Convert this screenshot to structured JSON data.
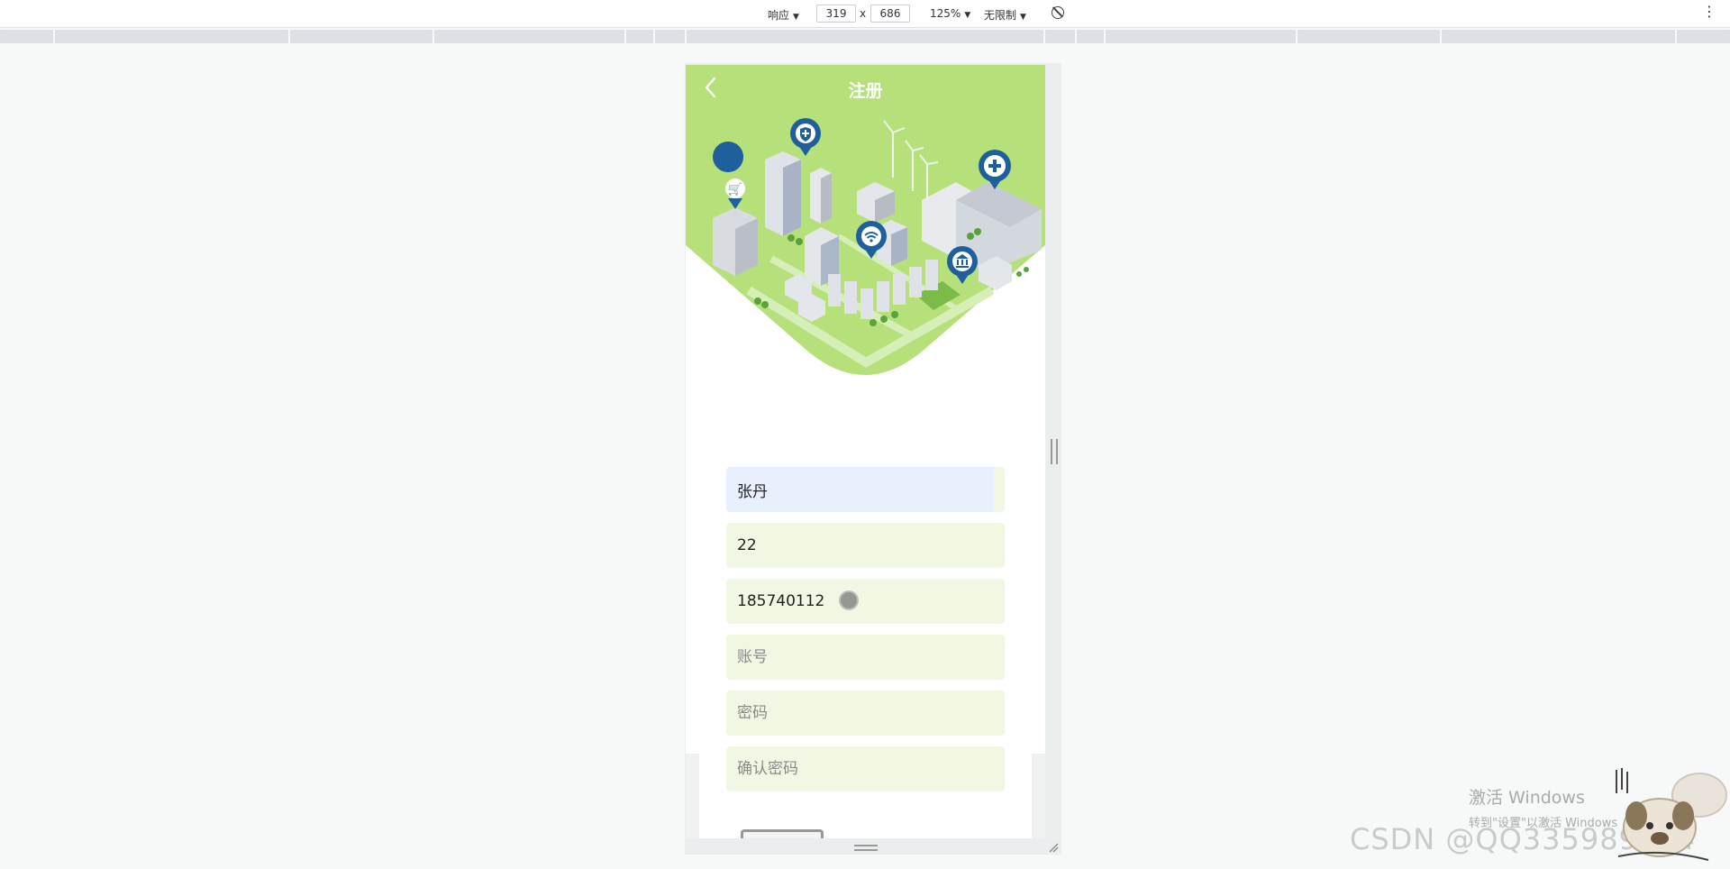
{
  "devtools": {
    "mode": "响应",
    "width": "319",
    "times": "x",
    "height": "686",
    "zoom": "125%",
    "throttle": "无限制",
    "more": "⋮"
  },
  "header": {
    "title": "注册",
    "back_icon": "chevron-left-icon"
  },
  "form": {
    "name_value": "张丹",
    "age_value": "22",
    "phone_value": "185740112",
    "account_placeholder": "账号",
    "password_placeholder": "密码",
    "confirm_placeholder": "确认密码"
  },
  "colors": {
    "hero_green": "#b5e07a",
    "field_bg": "#f0f8e4",
    "autofill_bg": "#e8f0fe",
    "pin_blue": "#1f5f9c"
  },
  "watermark": {
    "windows_line1": "激活 Windows",
    "windows_line2": "转到\"设置\"以激活 Windows",
    "csdn": "CSDN @QQ335989214"
  }
}
